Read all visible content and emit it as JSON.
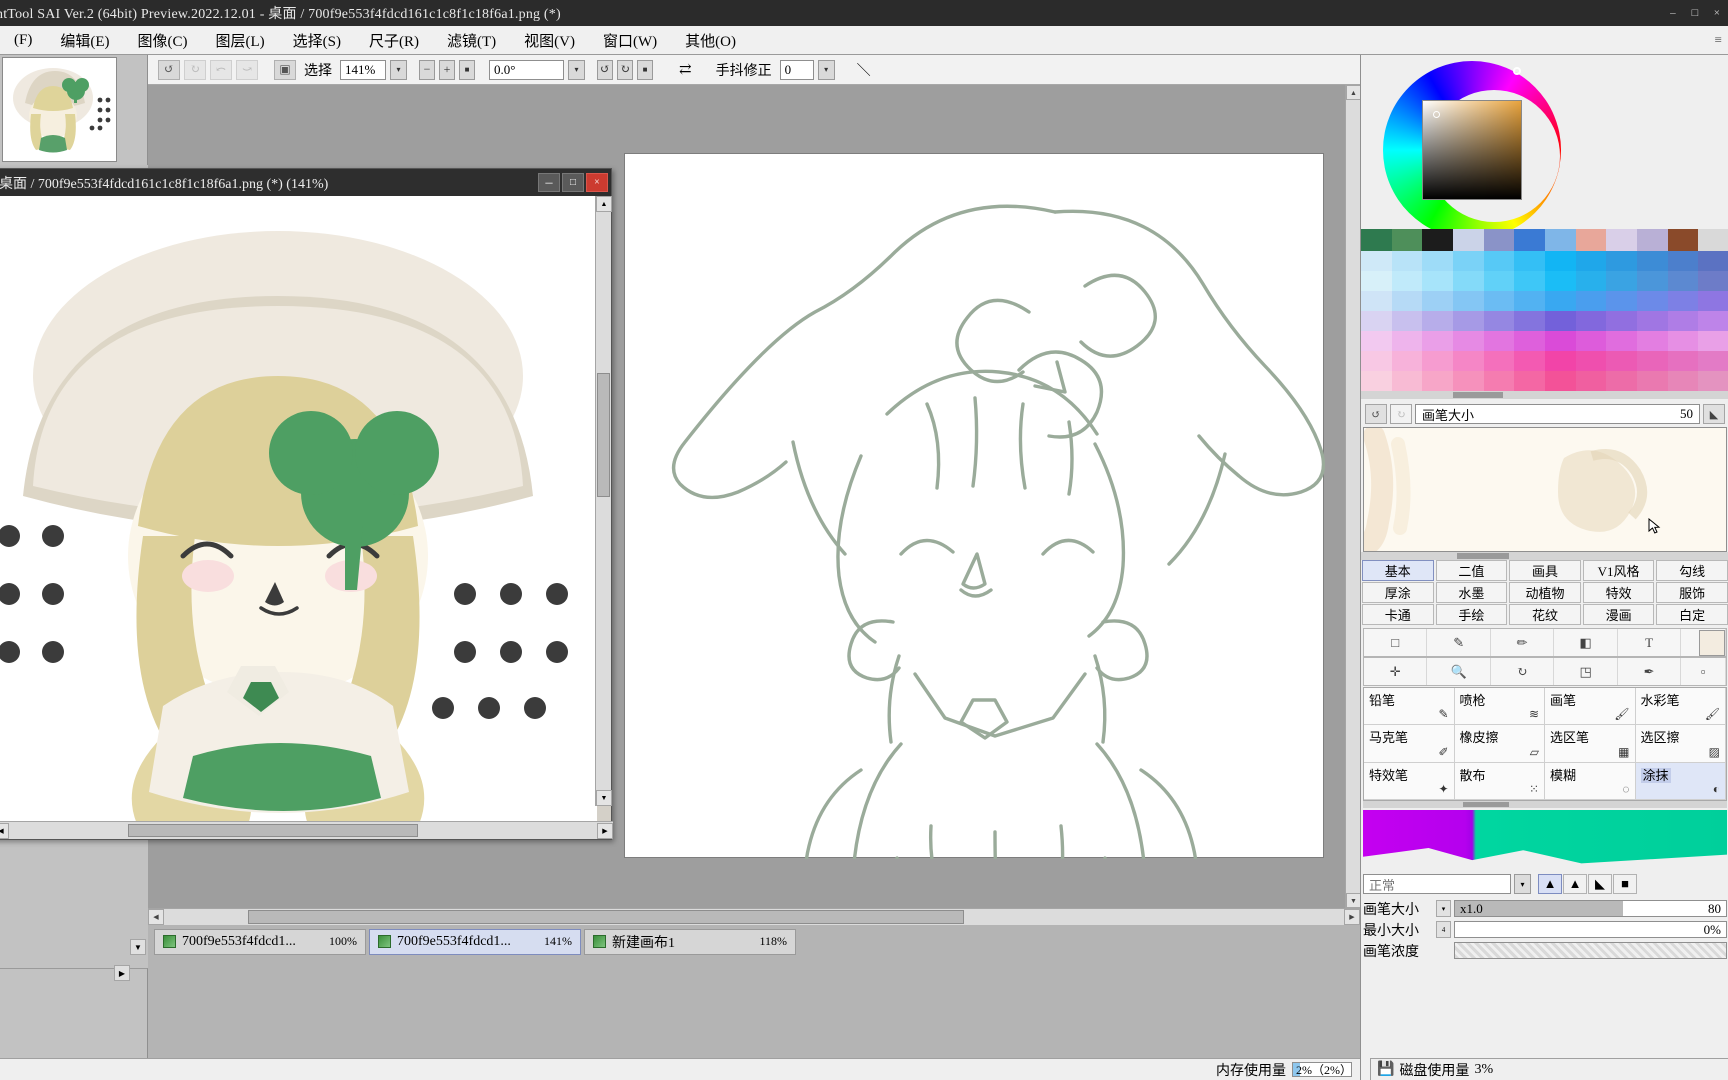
{
  "window": {
    "title": "ntTool SAI Ver.2 (64bit) Preview.2022.12.01 - 桌面 / 700f9e553f4fdcd161c1c8f1c18f6a1.png (*)",
    "minimize": "–",
    "maximize": "□",
    "close": "×"
  },
  "menu": {
    "items": [
      {
        "label": "(F)"
      },
      {
        "label": "编辑(E)"
      },
      {
        "label": "图像(C)"
      },
      {
        "label": "图层(L)"
      },
      {
        "label": "选择(S)"
      },
      {
        "label": "尺子(R)"
      },
      {
        "label": "滤镜(T)"
      },
      {
        "label": "视图(V)"
      },
      {
        "label": "窗口(W)"
      },
      {
        "label": "其他(O)"
      }
    ],
    "right_marker": "≡"
  },
  "toolbar": {
    "undo_icon": "↺",
    "redo_icon": "↻",
    "btn3_icon": "⤺",
    "btn4_icon": "⤻",
    "select_toggle_icon": "▣",
    "select_label": "选择",
    "zoom_value": "141%",
    "zoom_dropdown_icon": "▾",
    "zoom_out": "−",
    "zoom_in": "+",
    "zoom_reset": "■",
    "rotate_value": "0.0°",
    "rotate_dropdown_icon": "▾",
    "rotate_ccw": "↺",
    "rotate_cw": "↻",
    "rotate_reset": "■",
    "flip_icon": "⇄",
    "stabilizer_label": "手抖修正",
    "stabilizer_value": "0",
    "stabilizer_dropdown_icon": "▾",
    "pen_icon": "＼"
  },
  "document_window": {
    "title": "桌面 / 700f9e553f4fdcd161c1c8f1c18f6a1.png (*) (141%)",
    "minimize": "－",
    "maximize": "□",
    "close": "×"
  },
  "color_panel": {
    "swatches": [
      "#2e7a4f",
      "#4e8f5a",
      "#1c1c1c",
      "#cbd3e8",
      "#8a93c8",
      "#3a7ad4",
      "#7fb6e8",
      "#e8a79a",
      "#d9cfe8",
      "#b9b0d6",
      "#8a4a2a",
      "#d9d9d9"
    ],
    "palette_colors": [
      "#cfe9f8",
      "#b8e3f8",
      "#9edcf8",
      "#7ad2f7",
      "#57c9f6",
      "#34bff5",
      "#12b5f4",
      "#1fa7ea",
      "#2e9ae0",
      "#3d8cd6",
      "#4c7fcc",
      "#5b72c2",
      "#d7f0f9",
      "#c0eafa",
      "#a7e4fa",
      "#84daf9",
      "#61d1f8",
      "#3ec7f7",
      "#1bbdf6",
      "#28b0ec",
      "#3aa3e3",
      "#4b96da",
      "#5c89d1",
      "#6d7cc8",
      "#cfe4f7",
      "#b6daf6",
      "#9dd0f5",
      "#84c6f4",
      "#6bbcf3",
      "#52b2f2",
      "#39a8f1",
      "#4a9eee",
      "#5b94eb",
      "#6c8ae8",
      "#7d80e5",
      "#8e76e2",
      "#d9d3f2",
      "#c8c0ee",
      "#b7adea",
      "#a69ae6",
      "#9587e2",
      "#8474de",
      "#7361da",
      "#8268dd",
      "#916fe0",
      "#a076e3",
      "#af7de6",
      "#be84e9",
      "#f2c9f0",
      "#eeb4ec",
      "#ea9fe8",
      "#e68ae4",
      "#e275e0",
      "#de60dc",
      "#da4bd8",
      "#dd5cdb",
      "#e06dde",
      "#e37ee1",
      "#e68fe4",
      "#e9a0e7",
      "#f8c8e4",
      "#f7b2da",
      "#f69cd0",
      "#f586c6",
      "#f470bc",
      "#f35ab2",
      "#f244a8",
      "#ef4fae",
      "#ec5ab4",
      "#e965ba",
      "#e670c0",
      "#e37bc6",
      "#f9d0e0",
      "#f8bbd4",
      "#f7a6c8",
      "#f691bc",
      "#f57cb0",
      "#f467a4",
      "#f35298",
      "#f05fa0",
      "#ed6ca8",
      "#ea79b0",
      "#e786b8",
      "#e493c0"
    ],
    "palette_bg": "#e9e9f2"
  },
  "brush_size_panel": {
    "back_icon": "↺",
    "forward_icon": "↻",
    "label": "画笔大小",
    "value": "50",
    "expand_icon": "◣"
  },
  "category_tabs": {
    "rows": [
      [
        {
          "label": "基本",
          "active": true
        },
        {
          "label": "二值",
          "active": false
        },
        {
          "label": "画具",
          "active": false
        },
        {
          "label": "V1风格",
          "active": false
        },
        {
          "label": "勾线",
          "active": false
        }
      ],
      [
        {
          "label": "厚涂",
          "active": false
        },
        {
          "label": "水墨",
          "active": false
        },
        {
          "label": "动植物",
          "active": false
        },
        {
          "label": "特效",
          "active": false
        },
        {
          "label": "服饰",
          "active": false
        }
      ],
      [
        {
          "label": "卡通",
          "active": false
        },
        {
          "label": "手绘",
          "active": false
        },
        {
          "label": "花纹",
          "active": false
        },
        {
          "label": "漫画",
          "active": false
        },
        {
          "label": "白定",
          "active": false
        }
      ]
    ]
  },
  "tool_icons": {
    "row1": [
      "□",
      "✎",
      "✏",
      "◧",
      "T"
    ],
    "row2": [
      "✛",
      "🔍",
      "↻",
      "◳",
      "✒"
    ],
    "row2_extra": "▫"
  },
  "brush_grid": [
    {
      "name": "铅笔",
      "glyph": "✎",
      "selected": false
    },
    {
      "name": "喷枪",
      "glyph": "≋",
      "selected": false
    },
    {
      "name": "画笔",
      "glyph": "🖌",
      "selected": false
    },
    {
      "name": "水彩笔",
      "glyph": "🖌",
      "selected": false
    },
    {
      "name": "马克笔",
      "glyph": "✐",
      "selected": false
    },
    {
      "name": "橡皮擦",
      "glyph": "▱",
      "selected": false
    },
    {
      "name": "选区笔",
      "glyph": "▦",
      "selected": false
    },
    {
      "name": "选区擦",
      "glyph": "▨",
      "selected": false
    },
    {
      "name": "特效笔",
      "glyph": "✦",
      "selected": false
    },
    {
      "name": "散布",
      "glyph": "⁙",
      "selected": false
    },
    {
      "name": "模糊",
      "glyph": "◌",
      "selected": false
    },
    {
      "name": "涂抹",
      "glyph": "◐",
      "selected": true
    }
  ],
  "blend_mode": {
    "value": "正常",
    "dropdown_icon": "▾",
    "shapes": [
      {
        "glyph": "▲",
        "active": true
      },
      {
        "glyph": "▲",
        "active": false
      },
      {
        "glyph": "◣",
        "active": false
      },
      {
        "glyph": "■",
        "active": false
      }
    ]
  },
  "sliders": [
    {
      "label": "画笔大小",
      "dropdown": "▾",
      "left_text": "x1.0",
      "right_text": "80",
      "fill_pct": 62,
      "hatch": false
    },
    {
      "label": "最小大小",
      "dropdown": "4",
      "left_text": "",
      "right_text": "0%",
      "fill_pct": 0,
      "hatch": false
    },
    {
      "label": "画笔浓度",
      "dropdown": "",
      "left_text": "",
      "right_text": "",
      "fill_pct": 0,
      "hatch": true
    }
  ],
  "document_tabs": [
    {
      "name": "700f9e553f4fdcd1...",
      "zoom": "100%",
      "active": false
    },
    {
      "name": "700f9e553f4fdcd1...",
      "zoom": "141%",
      "active": true
    },
    {
      "name": "新建画布1",
      "zoom": "118%",
      "active": false
    }
  ],
  "status_bar": {
    "memory_label": "内存使用量",
    "memory_value": "2%（2%）",
    "memory_pct": 12,
    "disk_icon": "💾",
    "disk_label": "磁盘使用量",
    "disk_value": "3%",
    "disk_pct": 10
  },
  "scroll": {
    "up_arrow": "▲",
    "down_arrow": "▼",
    "left_arrow": "◀",
    "right_arrow": "▶"
  },
  "canvas": {
    "artwork_description": "chibi girl with clover hat sketch"
  }
}
